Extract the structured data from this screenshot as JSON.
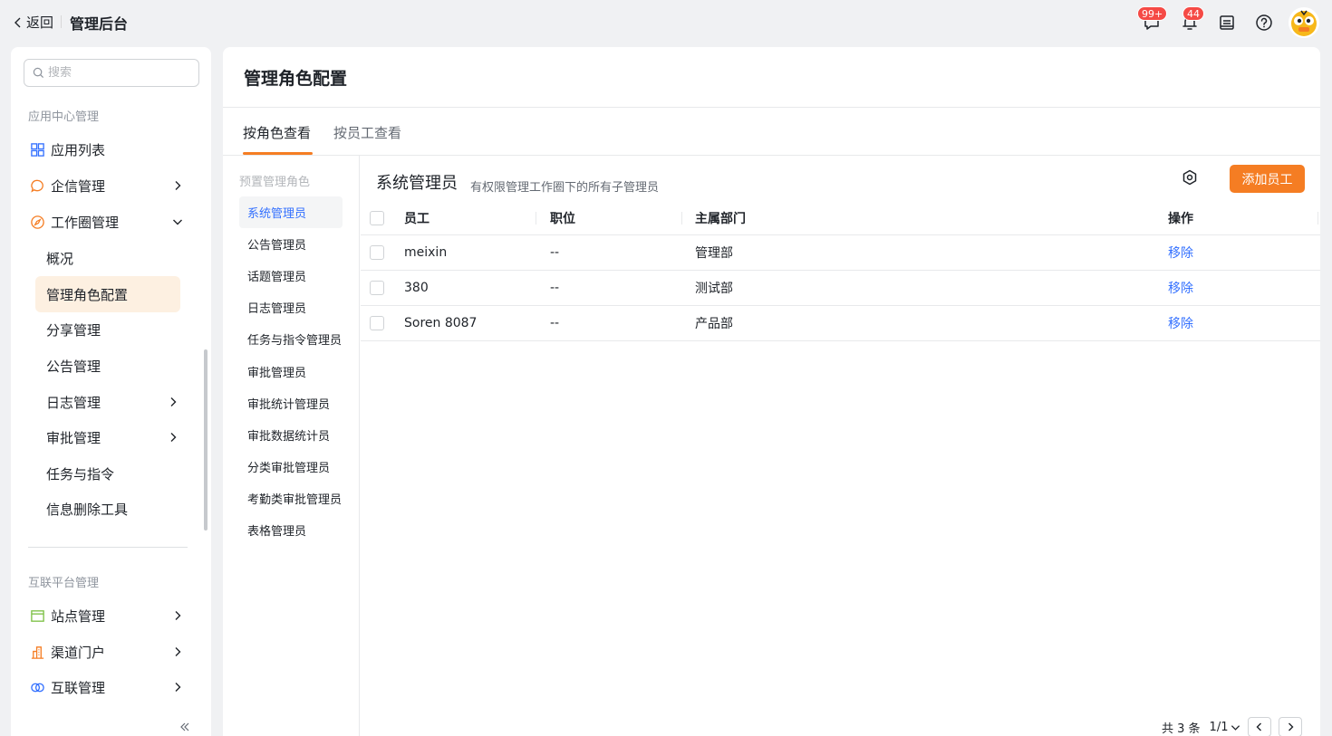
{
  "topbar": {
    "back_label": "返回",
    "app_title": "管理后台",
    "chat_badge": "99+",
    "notify_badge": "44"
  },
  "sidebar": {
    "search_placeholder": "搜索",
    "group1_title": "应用中心管理",
    "app_list": "应用列表",
    "qixin": "企信管理",
    "workcircle": "工作圈管理",
    "sub_items": [
      "概况",
      "管理角色配置",
      "分享管理",
      "公告管理",
      "日志管理",
      "审批管理",
      "任务与指令",
      "信息删除工具"
    ],
    "group2_title": "互联平台管理",
    "site_mgmt": "站点管理",
    "channel_portal": "渠道门户",
    "interconnect": "互联管理"
  },
  "main": {
    "title": "管理角色配置",
    "tabs": [
      "按角色查看",
      "按员工查看"
    ],
    "roles_heading": "预置管理角色",
    "roles": [
      "系统管理员",
      "公告管理员",
      "话题管理员",
      "日志管理员",
      "任务与指令管理员",
      "审批管理员",
      "审批统计管理员",
      "审批数据统计员",
      "分类审批管理员",
      "考勤类审批管理员",
      "表格管理员"
    ],
    "role_title": "系统管理员",
    "role_desc": "有权限管理工作圈下的所有子管理员",
    "add_button": "添加员工",
    "table": {
      "headers": [
        "员工",
        "职位",
        "主属部门",
        "操作"
      ],
      "rows": [
        {
          "name": "meixin",
          "position": "--",
          "dept": "管理部",
          "action": "移除"
        },
        {
          "name": "380",
          "position": "--",
          "dept": "测试部",
          "action": "移除"
        },
        {
          "name": "Soren 8087",
          "position": "--",
          "dept": "产品部",
          "action": "移除"
        }
      ]
    },
    "pager": {
      "total": "共 3 条",
      "page": "1/1"
    }
  },
  "colors": {
    "accent": "#f57d23",
    "link": "#3370ff",
    "badge": "#f54a45"
  }
}
